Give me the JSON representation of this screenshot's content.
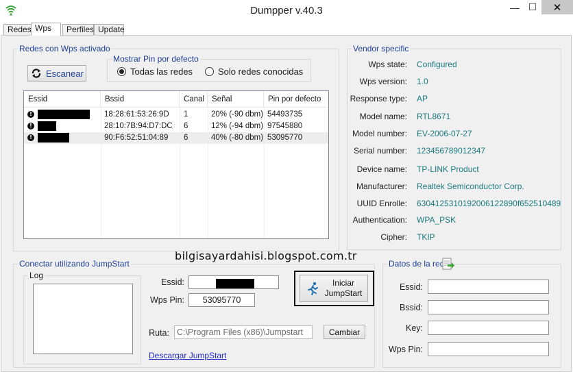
{
  "window": {
    "title": "Dumpper v.40.3",
    "min_glyph": "—",
    "max_glyph": "☐",
    "close_glyph": "✕"
  },
  "tabs": [
    {
      "label": "Redes",
      "active": false
    },
    {
      "label": "Wps",
      "active": true
    },
    {
      "label": "Perfiles",
      "active": false
    },
    {
      "label": "Update",
      "active": false
    }
  ],
  "wps_group": {
    "title": "Redes con Wps activado",
    "scan_button": "Escanear",
    "pin_group": {
      "title": "Mostrar Pin por defecto",
      "options": [
        {
          "label": "Todas las redes",
          "checked": true
        },
        {
          "label": "Solo redes conocidas",
          "checked": false
        }
      ]
    },
    "table": {
      "columns": [
        "Essid",
        "Bssid",
        "Canal",
        "Señal",
        "Pin por defecto"
      ],
      "rows": [
        {
          "essid": "",
          "bssid": "18:28:61:53:26:9D",
          "canal": "1",
          "senal": "20% (-90 dbm)",
          "pin": "54493735",
          "selected": false
        },
        {
          "essid": "",
          "bssid": "28:10:7B:94:D7:DC",
          "canal": "6",
          "senal": "12% (-94 dbm)",
          "pin": "97545880",
          "selected": false
        },
        {
          "essid": "",
          "bssid": "90:F6:52:51:04:89",
          "canal": "6",
          "senal": "40% (-80 dbm)",
          "pin": "53095770",
          "selected": true
        }
      ]
    }
  },
  "vendor": {
    "title": "Vendor specific",
    "fields": [
      {
        "label": "Wps state:",
        "value": "Configured"
      },
      {
        "label": "Wps version:",
        "value": "1.0"
      },
      {
        "label": "Response type:",
        "value": "AP"
      },
      {
        "label": "Model name:",
        "value": "RTL8671"
      },
      {
        "label": "Model number:",
        "value": "EV-2006-07-27"
      },
      {
        "label": "Serial number:",
        "value": "123456789012347"
      },
      {
        "label": "Device name:",
        "value": "TP-LINK Product"
      },
      {
        "label": "Manufacturer:",
        "value": "Realtek Semiconductor Corp."
      },
      {
        "label": "UUID Enrolle:",
        "value": "63041253101920061228​90f652510489"
      },
      {
        "label": "Authentication:",
        "value": "WPA_PSK"
      },
      {
        "label": "Cipher:",
        "value": "TKIP"
      }
    ]
  },
  "watermark": "bilgisayardahisi.blogspot.com.tr",
  "jumpstart": {
    "title": "Conectar utilizando JumpStart",
    "log_label": "Log",
    "essid_label": "Essid:",
    "essid_value": "",
    "wpspin_label": "Wps Pin:",
    "wpspin_value": "53095770",
    "start_line1": "Iniciar",
    "start_line2": "JumpStart",
    "ruta_label": "Ruta:",
    "ruta_value": "C:\\Program Files (x86)\\Jumpstart",
    "change_button": "Cambiar",
    "download_link": "Descargar JumpStart"
  },
  "network_data": {
    "title": "Datos de la red",
    "fields": [
      {
        "label": "Essid:",
        "value": ""
      },
      {
        "label": "Bssid:",
        "value": ""
      },
      {
        "label": "Key:",
        "value": ""
      },
      {
        "label": "Wps Pin:",
        "value": ""
      }
    ]
  },
  "colors": {
    "accent_label": "#1c3f94",
    "vendor_value": "#1a7a80",
    "link": "#1c26c8"
  }
}
